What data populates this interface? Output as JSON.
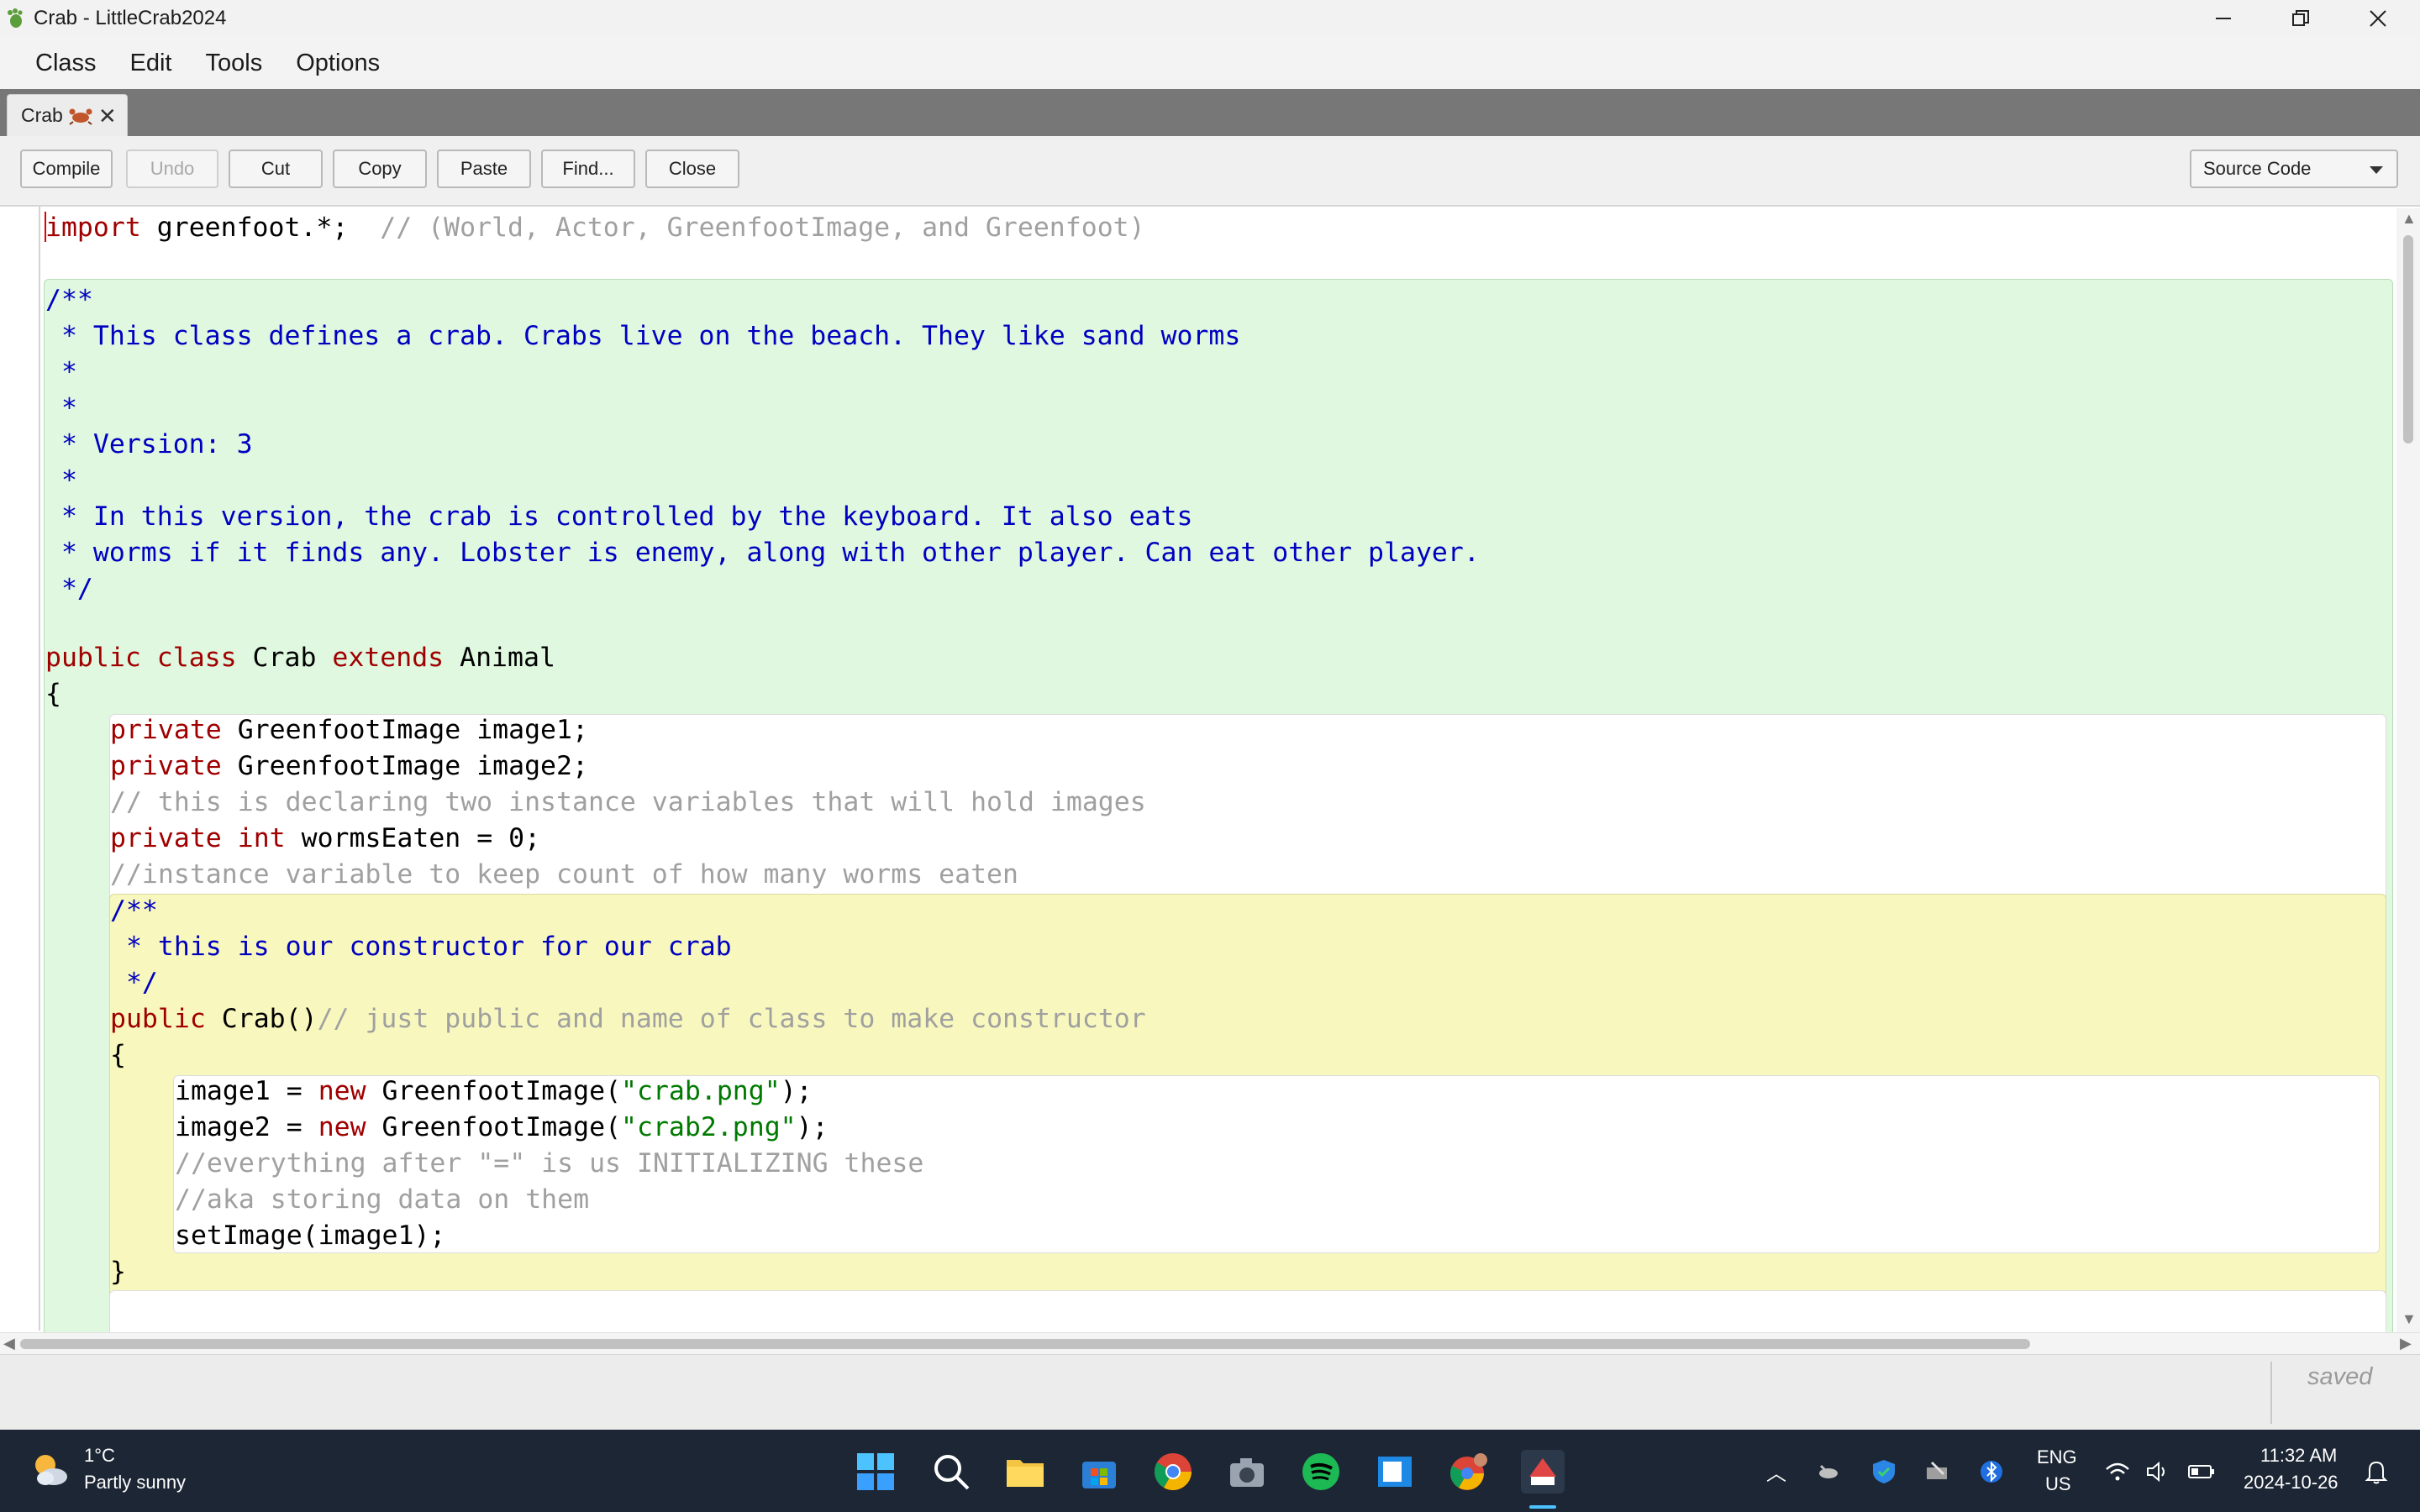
{
  "window": {
    "title": "Crab - LittleCrab2024",
    "controls": [
      "minimize",
      "restore",
      "close"
    ]
  },
  "menu": [
    "Class",
    "Edit",
    "Tools",
    "Options"
  ],
  "tab": {
    "label": "Crab",
    "icon": "crab-icon",
    "close": "✕"
  },
  "toolbar": {
    "buttons": [
      {
        "label": "Compile",
        "enabled": true
      },
      {
        "label": "Undo",
        "enabled": false
      },
      {
        "label": "Cut",
        "enabled": true
      },
      {
        "label": "Copy",
        "enabled": true
      },
      {
        "label": "Paste",
        "enabled": true
      },
      {
        "label": "Find...",
        "enabled": true
      },
      {
        "label": "Close",
        "enabled": true
      }
    ],
    "view_select": "Source Code"
  },
  "code": {
    "line_import": [
      "import",
      " greenfoot.*;  ",
      "// (World, Actor, GreenfootImage, and Greenfoot)"
    ],
    "doc_open": "/**",
    "doc_1": " * This class defines a crab. Crabs live on the beach. They like sand worms",
    "doc_2": " *",
    "doc_3": " *",
    "doc_4": " * Version: 3",
    "doc_5": " *",
    "doc_6": " * In this version, the crab is controlled by the keyboard. It also eats",
    "doc_7": " * worms if it finds any. Lobster is enemy, along with other player. Can eat other player.",
    "doc_close": " */",
    "class_decl": [
      "public",
      " ",
      "class",
      " Crab ",
      "extends",
      " Animal"
    ],
    "brace_open": "{",
    "field_1": [
      "private",
      " GreenfootImage image1;"
    ],
    "field_2": [
      "private",
      " GreenfootImage image2;"
    ],
    "field_comment_1": "// this is declaring two instance variables that will hold images",
    "field_3": [
      "private",
      " ",
      "int",
      " wormsEaten = 0;"
    ],
    "field_comment_2": "//instance variable to keep count of how many worms eaten",
    "ctor_doc_open": "/**",
    "ctor_doc_1": " * this is our constructor for our crab",
    "ctor_doc_close": " */",
    "ctor_decl": [
      "public",
      " Crab()",
      "// just public and name of class to make constructor"
    ],
    "ctor_brace_open": "{",
    "ctor_1": [
      "image1 = ",
      "new",
      " GreenfootImage(",
      "\"crab.png\"",
      ");"
    ],
    "ctor_2": [
      "image2 = ",
      "new",
      " GreenfootImage(",
      "\"crab2.png\"",
      ");"
    ],
    "ctor_comment_1": "//everything after \"=\" is us INITIALIZING these",
    "ctor_comment_2": "//aka storing data on them",
    "ctor_3": "setImage(image1);",
    "ctor_brace_close": "}"
  },
  "status": {
    "saved": "saved"
  },
  "taskbar": {
    "weather_temp": "1°C",
    "weather_desc": "Partly sunny",
    "lang_1": "ENG",
    "lang_2": "US",
    "time": "11:32 AM",
    "date": "2024-10-26",
    "pinned": [
      "start-icon",
      "search-icon",
      "file-explorer-icon",
      "microsoft-store-icon",
      "chrome-icon",
      "camera-icon",
      "spotify-icon",
      "app-window-icon",
      "chrome-profile-icon",
      "greenfoot-icon"
    ]
  },
  "colors": {
    "keyword": "#a00000",
    "comment": "#a0a0a0",
    "javadoc": "#0000c0",
    "string": "#007a00",
    "class_scope": "#e0f8e0",
    "method_scope": "#f8f8be",
    "taskbar": "#1c2634"
  }
}
